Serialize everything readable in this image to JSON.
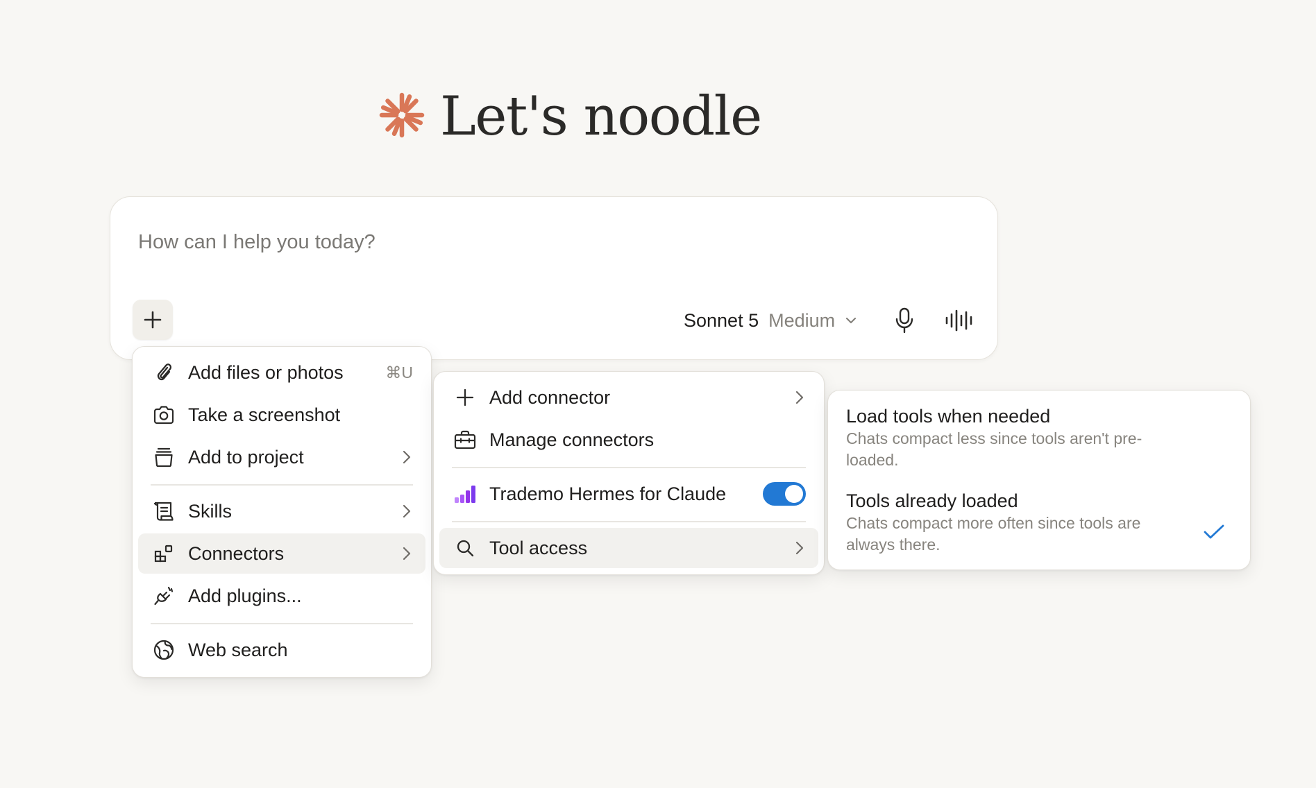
{
  "greeting": {
    "text": "Let's noodle"
  },
  "composer": {
    "placeholder": "How can I help you today?",
    "model_name": "Sonnet 5",
    "model_effort": "Medium"
  },
  "main_menu": {
    "items": [
      {
        "label": "Add files or photos",
        "shortcut": "⌘U",
        "icon": "paperclip-icon"
      },
      {
        "label": "Take a screenshot",
        "icon": "camera-icon"
      },
      {
        "label": "Add to project",
        "icon": "project-box-icon"
      },
      {
        "label": "Skills",
        "icon": "scroll-icon"
      },
      {
        "label": "Connectors",
        "icon": "connectors-icon"
      },
      {
        "label": "Add plugins...",
        "icon": "plug-icon"
      },
      {
        "label": "Web search",
        "icon": "globe-icon"
      }
    ]
  },
  "connectors_menu": {
    "items": [
      {
        "label": "Add connector",
        "icon": "plus-icon"
      },
      {
        "label": "Manage connectors",
        "icon": "toolbox-icon"
      },
      {
        "label": "Trademo Hermes for Claude",
        "icon": "bar-chart-icon",
        "enabled": true
      },
      {
        "label": "Tool access",
        "icon": "search-icon"
      }
    ]
  },
  "tool_access_menu": {
    "options": [
      {
        "title": "Load tools when needed",
        "description": "Chats compact less since tools aren't pre-loaded.",
        "selected": false
      },
      {
        "title": "Tools already loaded",
        "description": "Chats compact more often since tools are always there.",
        "selected": true
      }
    ]
  },
  "colors": {
    "accent_logo": "#d97757",
    "toggle_on": "#2279d4",
    "check": "#2279d4",
    "connector_icon": "#7c3aed"
  }
}
